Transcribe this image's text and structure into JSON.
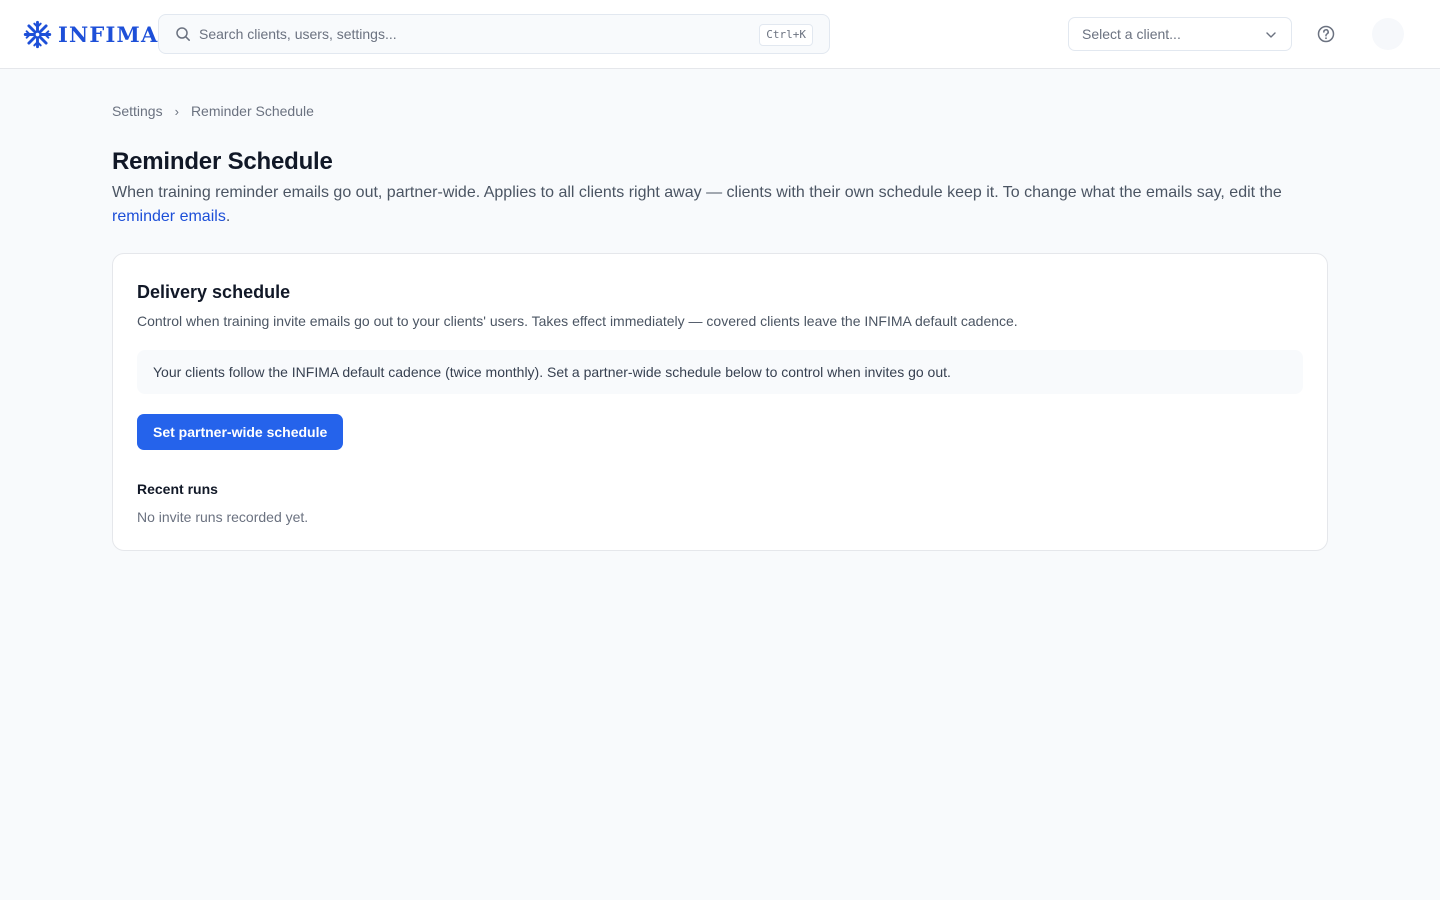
{
  "brand": {
    "name": "INFIMA",
    "color": "#1d4fd8"
  },
  "header": {
    "search": {
      "placeholder": "Search clients, users, settings...",
      "shortcut": "Ctrl+K",
      "icon": "search-icon"
    },
    "client_select": {
      "placeholder": "Select a client...",
      "icon": "chevron-down-icon"
    },
    "help_icon": "help-circle-icon"
  },
  "breadcrumb": {
    "parent": "Settings",
    "separator": "›",
    "current": "Reminder Schedule"
  },
  "page": {
    "title": "Reminder Schedule",
    "description_prefix": "When training reminder emails go out, partner-wide. Applies to all clients right away — clients with their own schedule keep it. To change what the emails say, edit the ",
    "description_link": "reminder emails",
    "description_suffix": "."
  },
  "delivery_card": {
    "title": "Delivery schedule",
    "description": "Control when training invite emails go out to your clients' users. Takes effect immediately — covered clients leave the INFIMA default cadence.",
    "notice": "Your clients follow the INFIMA default cadence (twice monthly). Set a partner-wide schedule below to control when invites go out.",
    "button_label": "Set partner-wide schedule",
    "button_color": "#2563eb",
    "recent_runs": {
      "title": "Recent runs",
      "empty_text": "No invite runs recorded yet."
    }
  }
}
